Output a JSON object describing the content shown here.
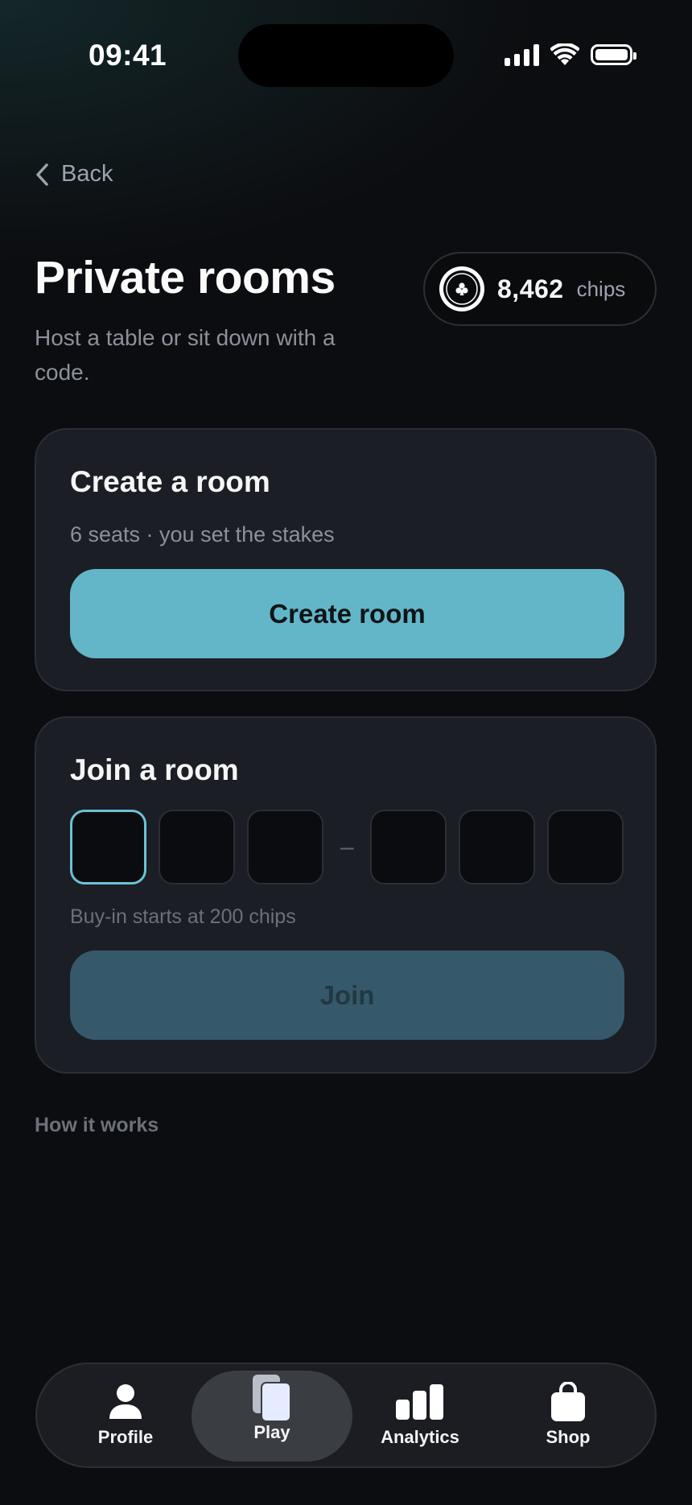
{
  "status_bar": {
    "time": "09:41"
  },
  "nav": {
    "back_label": "Back"
  },
  "header": {
    "title": "Private rooms",
    "subtitle": "Host a table or sit down with a code.",
    "chips_amount": "8,462",
    "chips_unit": "chips"
  },
  "create_card": {
    "title": "Create a room",
    "description": "6 seats · you set the stakes",
    "button_label": "Create room"
  },
  "join_card": {
    "title": "Join a room",
    "code_values": [
      "",
      "",
      "",
      "",
      "",
      ""
    ],
    "separator": "–",
    "hint": "Buy-in starts at 200 chips",
    "button_label": "Join"
  },
  "how_it_works": "How it works",
  "bottom_nav": {
    "items": [
      {
        "label": "Profile",
        "icon": "person-icon"
      },
      {
        "label": "Play",
        "icon": "cards-icon",
        "active": true
      },
      {
        "label": "Analytics",
        "icon": "bar-chart-icon"
      },
      {
        "label": "Shop",
        "icon": "shopping-bag-icon"
      }
    ]
  },
  "colors": {
    "accent": "#63b6c8",
    "accent_disabled": "#35596a",
    "background": "#0c0d10",
    "card": "#1c1e25"
  }
}
